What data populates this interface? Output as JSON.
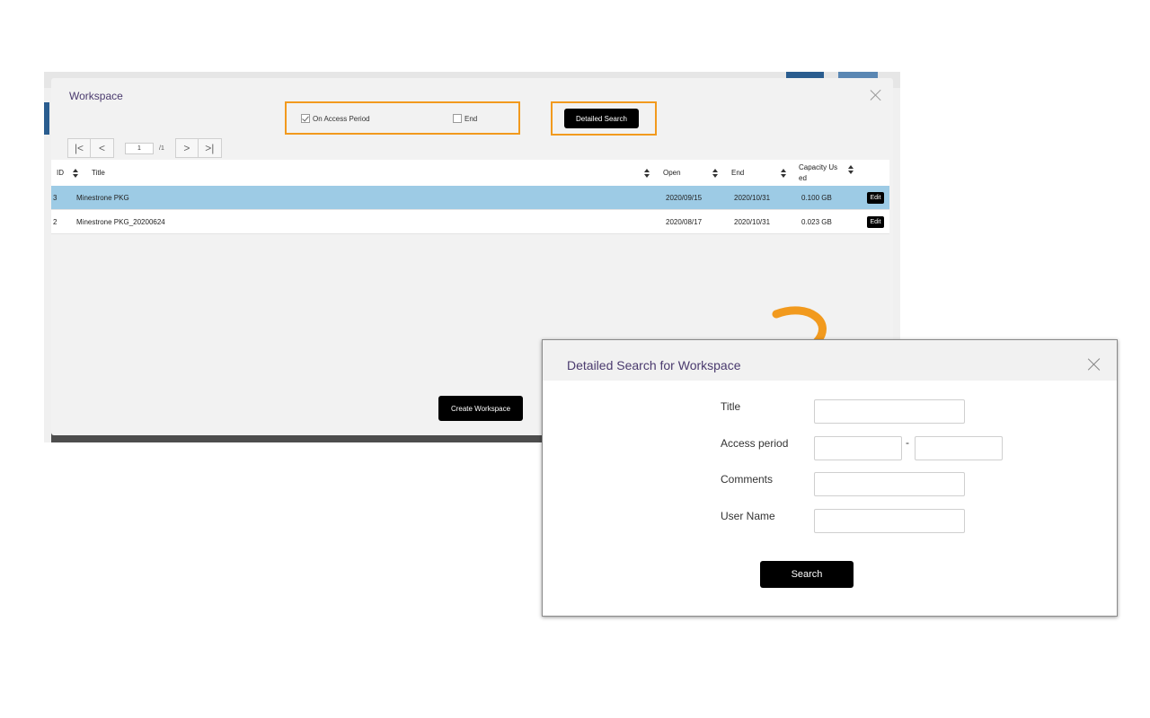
{
  "workspace_modal": {
    "title": "Workspace",
    "filters": {
      "on_access_period_label": "On Access Period",
      "on_access_period_checked": true,
      "end_label": "End",
      "end_checked": false
    },
    "detailed_search_label": "Detailed Search",
    "pager": {
      "first_glyph": "|<",
      "prev_glyph": "<",
      "page_value": "1",
      "total": "/1",
      "next_glyph": ">",
      "last_glyph": ">|"
    },
    "table": {
      "columns": {
        "id": "ID",
        "title": "Title",
        "open": "Open",
        "end": "End",
        "capacity": "Capacity Us ed"
      },
      "rows": [
        {
          "id": "3",
          "title": "Minestrone PKG",
          "open": "2020/09/15",
          "end": "2020/10/31",
          "capacity": "0.100 GB",
          "edit": "Edit",
          "selected": true
        },
        {
          "id": "2",
          "title": "Minestrone PKG_20200624",
          "open": "2020/08/17",
          "end": "2020/10/31",
          "capacity": "0.023 GB",
          "edit": "Edit",
          "selected": false
        }
      ]
    },
    "create_button_label": "Create Workspace"
  },
  "detailed_search_modal": {
    "title": "Detailed Search for Workspace",
    "fields": {
      "title_label": "Title",
      "title_value": "",
      "access_period_label": "Access period",
      "access_from_value": "",
      "separator": "-",
      "access_to_value": "",
      "comments_label": "Comments",
      "comments_value": "",
      "user_name_label": "User Name",
      "user_name_value": ""
    },
    "search_button_label": "Search"
  },
  "colors": {
    "highlight": "#f29a1e",
    "selected_row": "#9dcbe5",
    "title_purple": "#4a3a6e",
    "arrow": "#f29a1e"
  },
  "icons": [
    "close-icon",
    "checkbox-icon",
    "sort-icon",
    "curved-arrow-icon"
  ]
}
